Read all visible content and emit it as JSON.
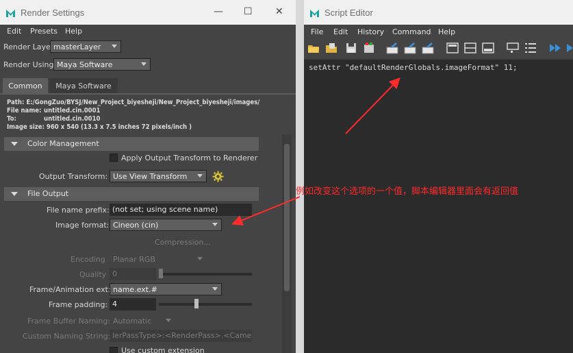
{
  "render_settings": {
    "title": "Render Settings",
    "menu": [
      "Edit",
      "Presets",
      "Help"
    ],
    "render_layer_label": "Render Layer",
    "render_layer_value": "masterLayer",
    "render_using_label": "Render Using",
    "render_using_value": "Maya Software",
    "tabs": [
      "Common",
      "Maya Software"
    ],
    "info": {
      "path": "Path: E:/GongZuo/BYSJ/New_Project_biyesheji/New_Project_biyesheji/images/",
      "file_name_label": "File name:",
      "file_name": "untitled.cin.0001",
      "to_label": "To:",
      "to": "untitled.cin.0010",
      "image_size": "Image size: 960 x 540 (13.3 x 7.5 inches 72 pixels/inch )"
    },
    "color_management": {
      "header": "Color Management",
      "apply_output_transform": "Apply Output Transform to Renderer",
      "output_transform_label": "Output Transform:",
      "output_transform_value": "Use View Transform"
    },
    "file_output": {
      "header": "File Output",
      "file_name_prefix_label": "File name prefix:",
      "file_name_prefix_value": "(not set; using scene name)",
      "image_format_label": "Image format:",
      "image_format_value": "Cineon (cin)",
      "compression_label": "Compression...",
      "encoding_label": "Encoding",
      "encoding_value": "Planar RGB",
      "quality_label": "Quality",
      "quality_value": "0",
      "frame_animation_ext_label": "Frame/Animation ext:",
      "frame_animation_ext_value": "name.ext.#",
      "frame_padding_label": "Frame padding:",
      "frame_padding_value": "4",
      "frame_buffer_naming_label": "Frame Buffer Naming:",
      "frame_buffer_naming_value": "Automatic",
      "custom_naming_string_label": "Custom Naming String:",
      "custom_naming_string_value": "lerPassType>:<RenderPass>.<Camera>",
      "use_custom_extension": "Use custom extension"
    }
  },
  "script_editor": {
    "title": "Script Editor",
    "menu": [
      "File",
      "Edit",
      "History",
      "Command",
      "Help"
    ],
    "code": "setAttr \"defaultRenderGlobals.imageFormat\" 11;"
  },
  "annotation": {
    "text": "例如改变这个选项的一个值，脚本编辑器里面会有返回值",
    "color": "#ff2a2a"
  },
  "colors": {
    "panel_bg": "#444444",
    "field_bg": "#2b2b2b",
    "section_bg": "#5d5d5d",
    "titlebar_bg": "#f0f0f0",
    "maya_logo": "#1aa3a3"
  }
}
